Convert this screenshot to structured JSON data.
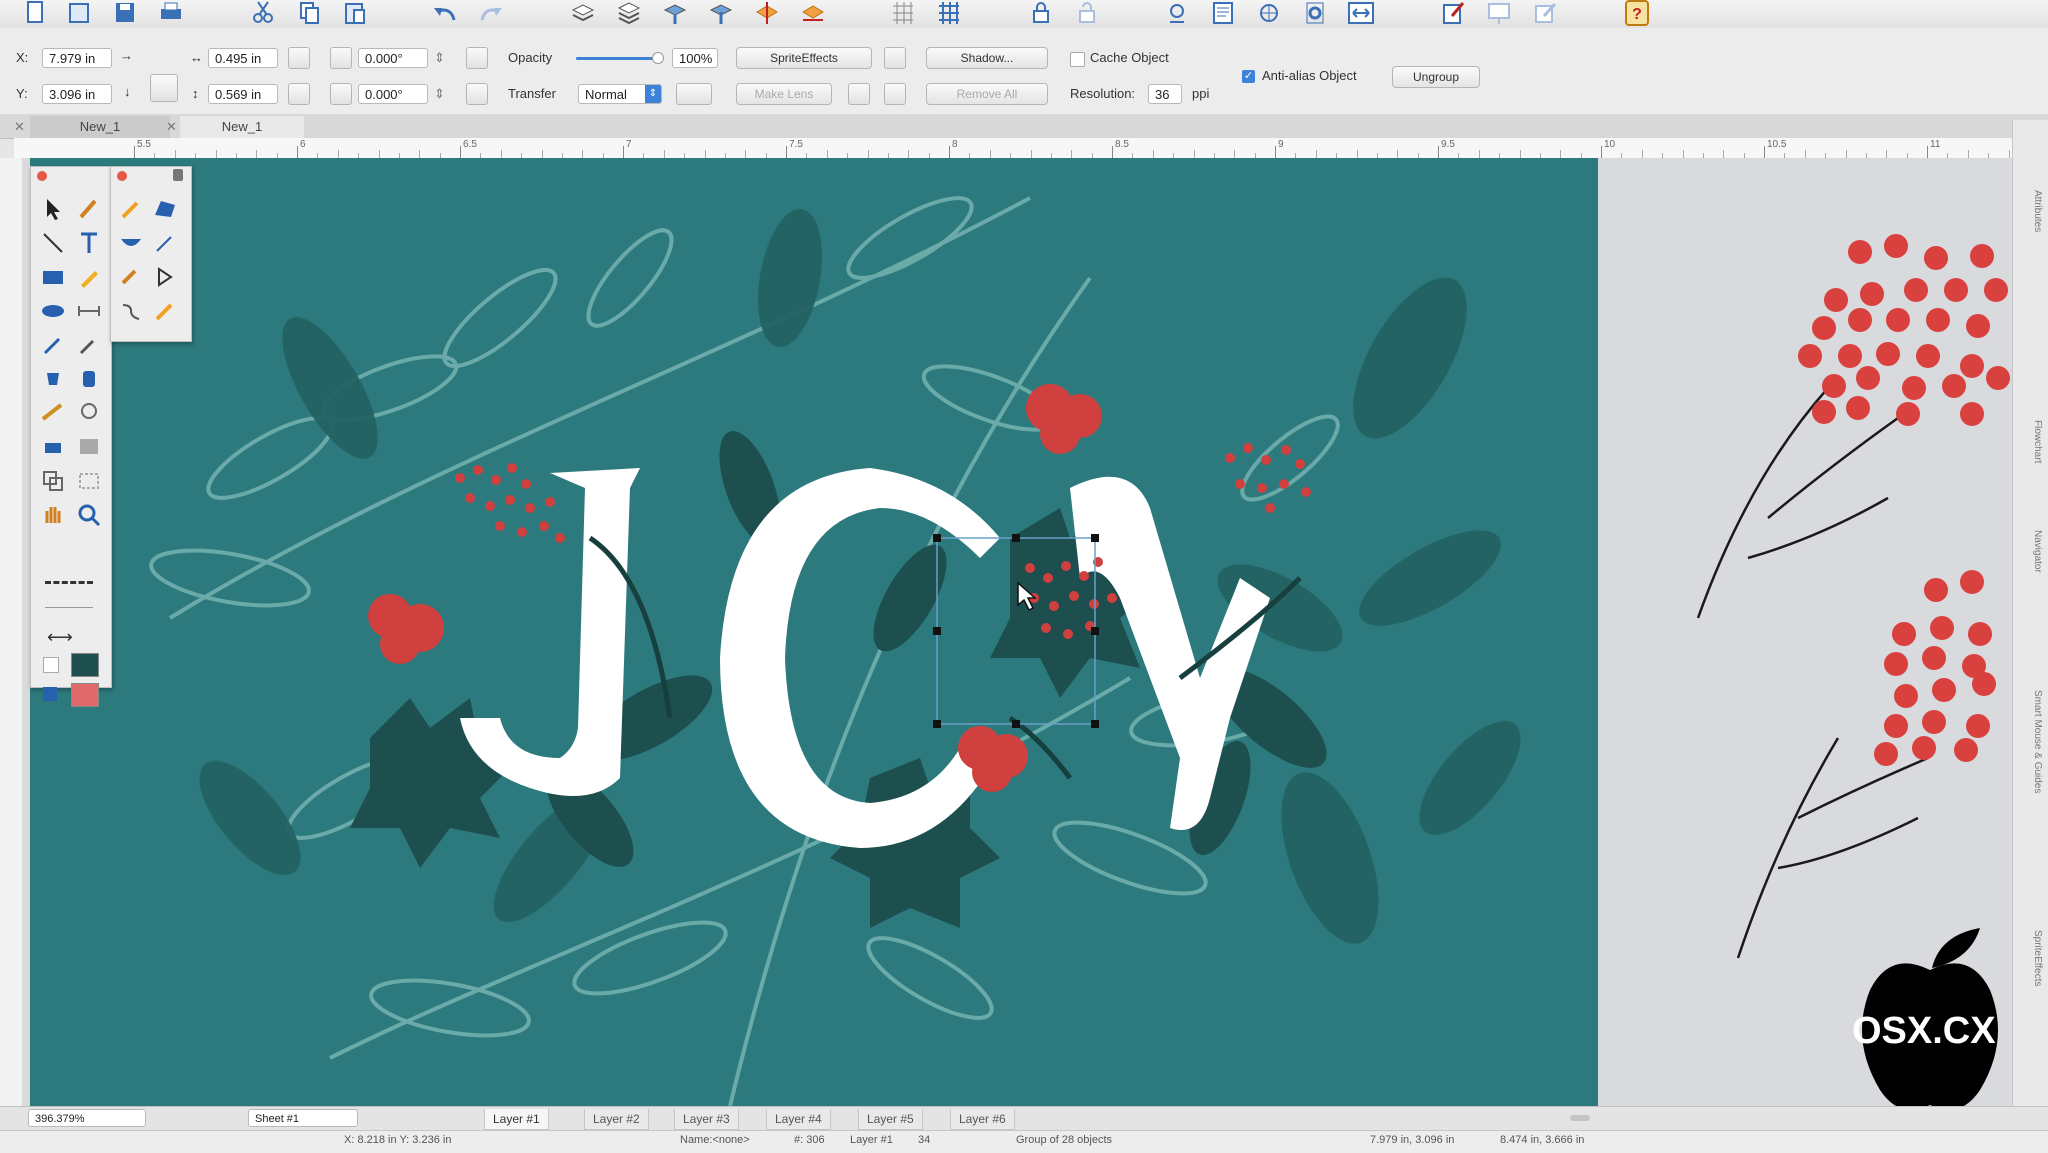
{
  "document_tabs": [
    {
      "label": "New_1"
    },
    {
      "label": "New_1"
    }
  ],
  "inspector": {
    "x_label": "X:",
    "x_value": "7.979 in",
    "y_label": "Y:",
    "y_value": "3.096 in",
    "width_value": "0.495 in",
    "height_value": "0.569 in",
    "rotation_value": "0.000°",
    "skew_value": "0.000°",
    "opacity_label": "Opacity",
    "opacity_value": "100%",
    "opacity_level": 1.0,
    "transfer_label": "Transfer",
    "transfer_value": "Normal",
    "sprite_effects": "SpriteEffects",
    "make_lens": "Make Lens",
    "shadow": "Shadow...",
    "remove_all": "Remove All",
    "cache_object": "Cache Object",
    "cache_checked": false,
    "resolution_label": "Resolution:",
    "resolution_value": "36",
    "resolution_unit": "ppi",
    "antialias": "Anti-alias Object",
    "antialias_checked": true,
    "ungroup": "Ungroup"
  },
  "ruler_ticks": [
    "5.5",
    "6",
    "6.5",
    "7",
    "7.5",
    "8",
    "8.5",
    "9",
    "9.5",
    "10",
    "10.5",
    "11"
  ],
  "layers": [
    "Layer #1",
    "Layer #2",
    "Layer #3",
    "Layer #4",
    "Layer #5",
    "Layer #6"
  ],
  "active_layer": "Layer #1",
  "bottom": {
    "zoom": "396.379%",
    "sheet": "Sheet #1"
  },
  "status": {
    "cursor": "X: 8.218 in     Y: 3.236 in",
    "name": "Name:<none>",
    "id": "#: 306",
    "layer": "Layer #1",
    "count": "34",
    "selection": "Group of 28 objects",
    "position": "7.979 in, 3.096 in",
    "size": "8.474 in, 3.666 in"
  },
  "side_panels": [
    "Attributes",
    "Flowchart",
    "Navigator",
    "Smart Mouse & Guides",
    "SpriteEffects"
  ],
  "artwork_text": "JOY",
  "watermark": "OSX.CX",
  "colors": {
    "canvas_bg": "#2c7a7d",
    "leaf_dark": "#1f5352",
    "berry": "#d0403e",
    "letters": "#ffffff"
  }
}
